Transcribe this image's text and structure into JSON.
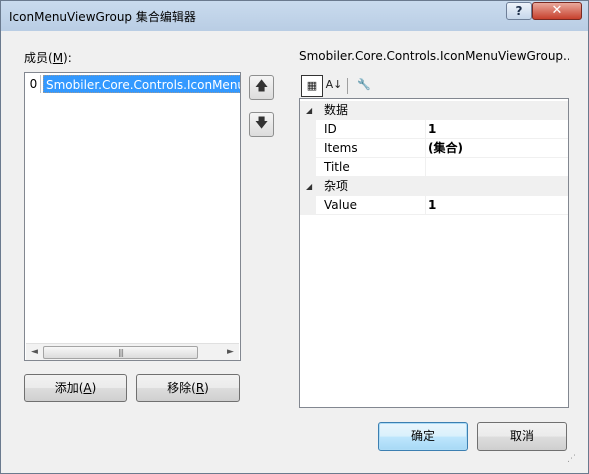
{
  "window": {
    "title": "IconMenuViewGroup 集合编辑器",
    "help_label": "?",
    "close_label": "✕"
  },
  "members": {
    "label_prefix": "成员(",
    "label_key": "M",
    "label_suffix": "):",
    "items": [
      {
        "index": "0",
        "text": "Smobiler.Core.Controls.IconMenu"
      }
    ],
    "scroll_left": "◄",
    "scroll_right": "►",
    "scroll_thumb": "|||"
  },
  "move_up_glyph": "🡅",
  "move_down_glyph": "🡇",
  "buttons": {
    "add": {
      "text": "添加(",
      "key": "A",
      "end": ")"
    },
    "remove": {
      "text": "移除(",
      "key": "R",
      "end": ")"
    },
    "ok": "确定",
    "cancel": "取消"
  },
  "properties": {
    "header": "Smobiler.Core.Controls.IconMenuViewGroup...",
    "toolbar": {
      "categorized": "▦",
      "alphabetical": "A↓",
      "pages": "🔧"
    },
    "categories": [
      {
        "name": "数据",
        "toggle": "◢",
        "props": [
          {
            "name": "ID",
            "value": "1"
          },
          {
            "name": "Items",
            "value": "(集合)"
          },
          {
            "name": "Title",
            "value": ""
          }
        ]
      },
      {
        "name": "杂项",
        "toggle": "◢",
        "props": [
          {
            "name": "Value",
            "value": "1"
          }
        ]
      }
    ]
  }
}
